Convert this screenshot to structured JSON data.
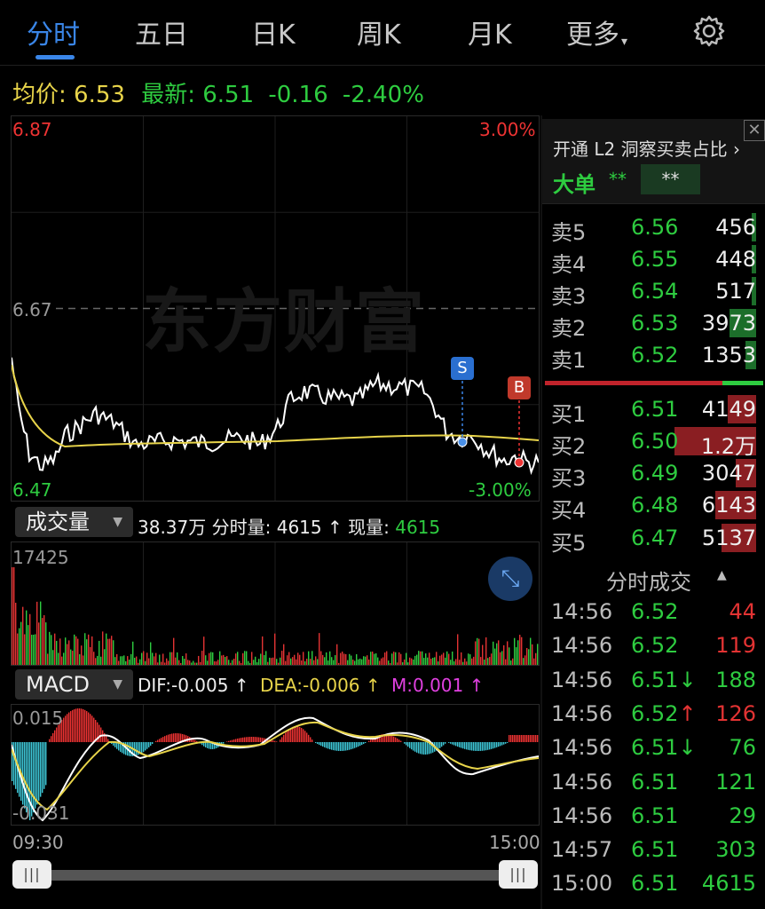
{
  "tabs": [
    {
      "label": "分时",
      "active": true
    },
    {
      "label": "五日",
      "active": false
    },
    {
      "label": "日K",
      "active": false
    },
    {
      "label": "周K",
      "active": false
    },
    {
      "label": "月K",
      "active": false
    },
    {
      "label": "更多",
      "active": false
    }
  ],
  "header": {
    "avg_label": "均价:",
    "avg_value": "6.53",
    "latest_label": "最新:",
    "latest_value": "6.51",
    "change": "-0.16",
    "change_pct": "-2.40%"
  },
  "price_axis": {
    "high": "6.87",
    "mid": "6.67",
    "low": "6.47",
    "high_pct": "3.00%",
    "low_pct": "-3.00%"
  },
  "watermark": "东方财富",
  "markers": {
    "sell": "S",
    "buy": "B"
  },
  "volume": {
    "indicator_label": "成交量",
    "total": "38.37万",
    "period_label": "分时量:",
    "period_value": "4615",
    "period_arrow": "↑",
    "current_label": "现量:",
    "current_value": "4615",
    "max_label": "17425"
  },
  "macd": {
    "indicator_label": "MACD",
    "dif": "DIF:-0.005 ↑",
    "dea": "DEA:-0.006 ↑",
    "m": "M:0.001 ↑",
    "max_label": "0.015",
    "min_label": "-0.031"
  },
  "time_axis": {
    "start": "09:30",
    "end": "15:00"
  },
  "l2": {
    "title": "开通 L2 洞察买卖占比",
    "big_order_label": "大单",
    "stars_1": "**",
    "stars_2": "**"
  },
  "order_book": {
    "asks": [
      {
        "label": "卖5",
        "price": "6.56",
        "volume": "456",
        "bar": 0.02
      },
      {
        "label": "卖4",
        "price": "6.55",
        "volume": "448",
        "bar": 0.02
      },
      {
        "label": "卖3",
        "price": "6.54",
        "volume": "517",
        "bar": 0.02
      },
      {
        "label": "卖2",
        "price": "6.53",
        "volume": "3973",
        "bar": 0.13
      },
      {
        "label": "卖1",
        "price": "6.52",
        "volume": "1353",
        "bar": 0.05
      }
    ],
    "bids": [
      {
        "label": "买1",
        "price": "6.51",
        "volume": "4149",
        "bar": 0.14
      },
      {
        "label": "买2",
        "price": "6.50",
        "volume": "1.2万",
        "bar": 0.4
      },
      {
        "label": "买3",
        "price": "6.49",
        "volume": "3047",
        "bar": 0.1
      },
      {
        "label": "买4",
        "price": "6.48",
        "volume": "6143",
        "bar": 0.2
      },
      {
        "label": "买5",
        "price": "6.47",
        "volume": "5137",
        "bar": 0.17
      }
    ]
  },
  "ticks": {
    "title": "分时成交",
    "rows": [
      {
        "time": "14:56",
        "price": "6.52",
        "arrow": "",
        "volume": "44",
        "dir": "sell"
      },
      {
        "time": "14:56",
        "price": "6.52",
        "arrow": "",
        "volume": "119",
        "dir": "sell"
      },
      {
        "time": "14:56",
        "price": "6.51",
        "arrow": "↓",
        "volume": "188",
        "dir": "buy"
      },
      {
        "time": "14:56",
        "price": "6.52",
        "arrow": "↑",
        "volume": "126",
        "dir": "sell"
      },
      {
        "time": "14:56",
        "price": "6.51",
        "arrow": "↓",
        "volume": "76",
        "dir": "buy"
      },
      {
        "time": "14:56",
        "price": "6.51",
        "arrow": "",
        "volume": "121",
        "dir": "buy"
      },
      {
        "time": "14:56",
        "price": "6.51",
        "arrow": "",
        "volume": "29",
        "dir": "buy"
      },
      {
        "time": "14:57",
        "price": "6.51",
        "arrow": "",
        "volume": "303",
        "dir": "buy"
      },
      {
        "time": "15:00",
        "price": "6.51",
        "arrow": "",
        "volume": "4615",
        "dir": "buy"
      }
    ]
  },
  "colors": {
    "up": "#e33333",
    "down": "#2ecc40",
    "avg_line": "#e8d44a",
    "price_line": "#ffffff",
    "accent": "#3a86e8",
    "magenta": "#e040e0"
  }
}
